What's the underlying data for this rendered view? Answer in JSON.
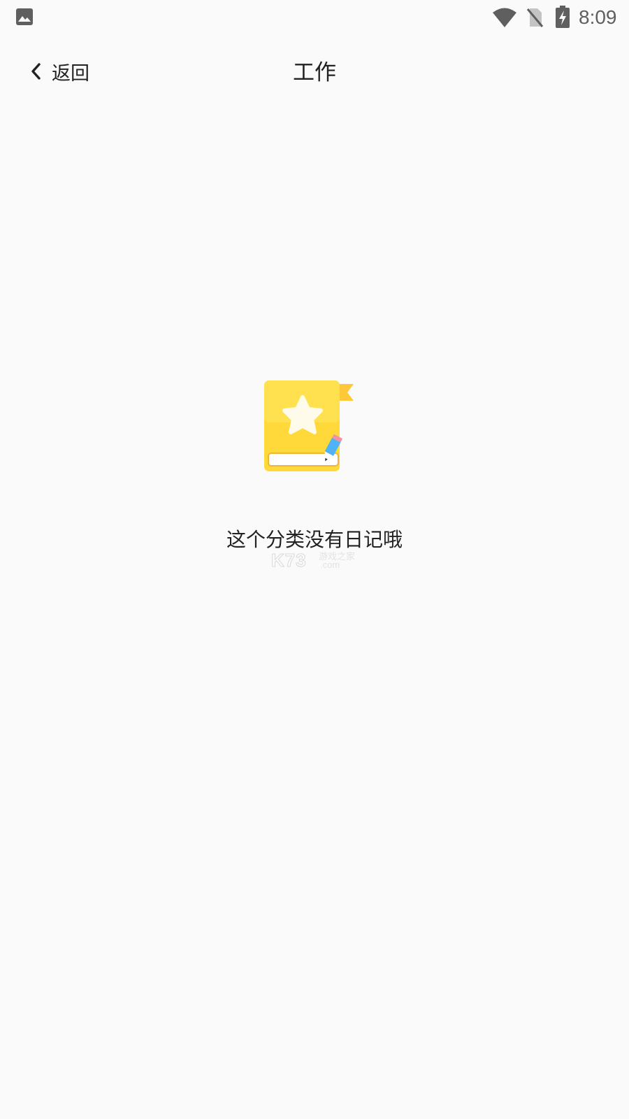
{
  "status_bar": {
    "time": "8:09",
    "icons": [
      "gallery-icon",
      "wifi-icon",
      "no-sim-icon",
      "battery-charging-icon"
    ]
  },
  "header": {
    "back_label": "返回",
    "title": "工作"
  },
  "empty_state": {
    "illustration": "diary-book-star-icon",
    "message": "这个分类没有日记哦"
  },
  "watermark": {
    "logo": "K73",
    "text": "游戏之家",
    "domain": ".com"
  },
  "colors": {
    "background": "#fafafa",
    "book_yellow": "#ffd83a",
    "ribbon": "#ffc838",
    "pencil_blue": "#4fb3f6",
    "text": "#222222"
  }
}
